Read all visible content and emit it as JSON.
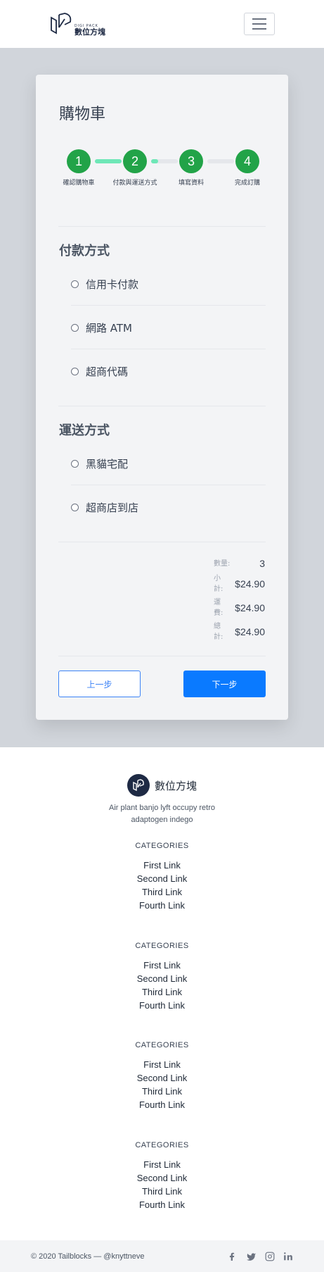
{
  "header": {
    "logo_sub": "DIGI PACK",
    "logo_name": "數位方塊"
  },
  "cart": {
    "title": "購物車",
    "steps": [
      {
        "number": "1",
        "label": "確認購物車"
      },
      {
        "number": "2",
        "label": "付款與運送方式"
      },
      {
        "number": "3",
        "label": "填寫資料"
      },
      {
        "number": "4",
        "label": "完成訂購"
      }
    ],
    "progress": {
      "line_1": 1.0,
      "line_2": 0.25,
      "line_3": 0.0
    },
    "payment": {
      "title": "付款方式",
      "options": [
        "信用卡付款",
        "網路 ATM",
        "超商代碼"
      ]
    },
    "shipping": {
      "title": "運送方式",
      "options": [
        "黑貓宅配",
        "超商店到店"
      ]
    },
    "summary": {
      "quantity_label": "數量:",
      "quantity": "3",
      "subtotal_label": "小計:",
      "subtotal": "$24.90",
      "shipping_label": "運費:",
      "shipping_fee": "$24.90",
      "total_label": "總計:",
      "total": "$24.90"
    },
    "prev_label": "上一步",
    "next_label": "下一步"
  },
  "footer": {
    "brand": "數位方塊",
    "description": "Air plant banjo lyft occupy retro adaptogen indego",
    "categories": [
      {
        "title": "CATEGORIES",
        "links": [
          "First Link",
          "Second Link",
          "Third Link",
          "Fourth Link"
        ]
      },
      {
        "title": "CATEGORIES",
        "links": [
          "First Link",
          "Second Link",
          "Third Link",
          "Fourth Link"
        ]
      },
      {
        "title": "CATEGORIES",
        "links": [
          "First Link",
          "Second Link",
          "Third Link",
          "Fourth Link"
        ]
      },
      {
        "title": "CATEGORIES",
        "links": [
          "First Link",
          "Second Link",
          "Third Link",
          "Fourth Link"
        ]
      }
    ],
    "copyright": "© 2020 Tailblocks — @knyttneve",
    "socials": [
      "facebook-icon",
      "twitter-icon",
      "instagram-icon",
      "linkedin-icon"
    ]
  },
  "colors": {
    "step_green": "#22a348",
    "progress_fill": "#6ee7b7",
    "primary_blue": "#0a7aff",
    "brand_navy": "#1e2a44"
  }
}
